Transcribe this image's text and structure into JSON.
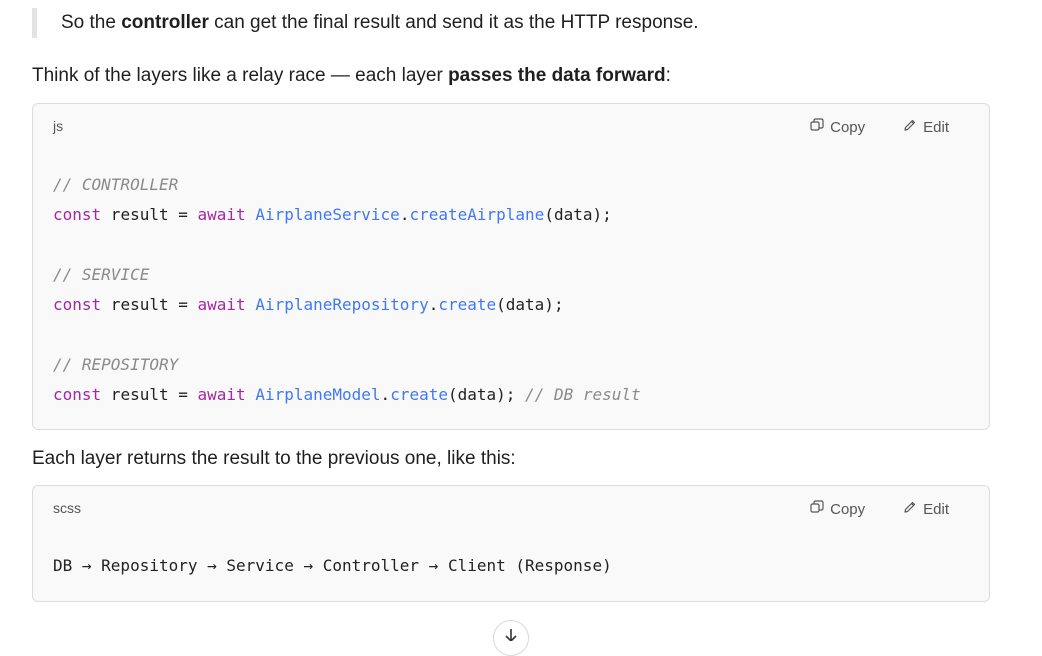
{
  "quote": {
    "before": "So the ",
    "bold": "controller",
    "after": " can get the final result and send it as the HTTP response."
  },
  "para1": {
    "before": "Think of the layers like a relay race — each layer ",
    "bold": "passes the data forward",
    "after": ":"
  },
  "code1": {
    "lang": "js",
    "copy_label": "Copy",
    "edit_label": "Edit",
    "c1": "// CONTROLLER",
    "c2": "// SERVICE",
    "c3": "// REPOSITORY",
    "const": "const",
    "result": " result = ",
    "await": "await",
    "svc": "AirplaneService",
    "repo": "AirplaneRepository",
    "model": "AirplaneModel",
    "dot": ".",
    "createAirplane": "createAirplane",
    "create": "create",
    "args": "(data);",
    "trail": " // DB result"
  },
  "para2": "Each layer returns the result to the previous one, like this:",
  "code2": {
    "lang": "scss",
    "copy_label": "Copy",
    "edit_label": "Edit",
    "line": "DB → Repository → Service → Controller → Client (Response)"
  },
  "icons": [
    "copy-icon",
    "edit-icon",
    "scroll-down-icon"
  ]
}
